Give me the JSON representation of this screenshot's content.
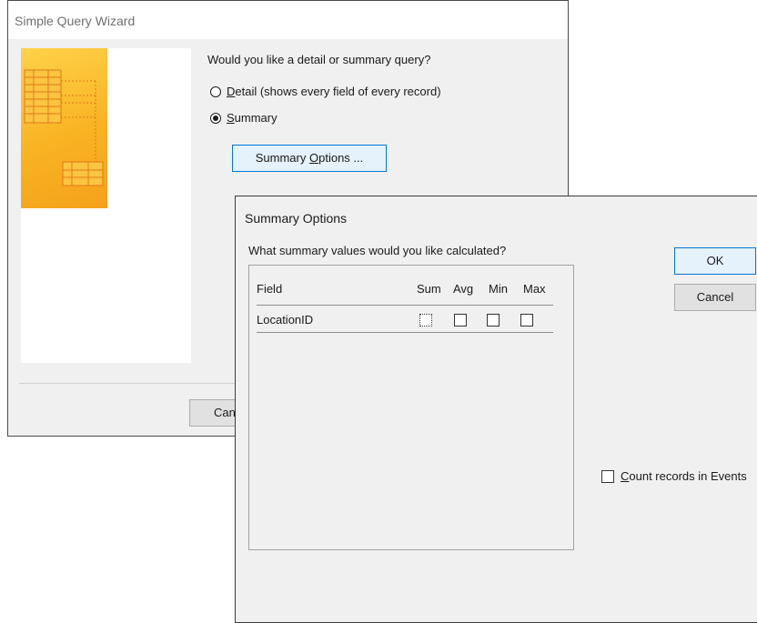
{
  "wizard": {
    "title": "Simple Query Wizard",
    "question": "Would you like a detail or summary query?",
    "options": [
      {
        "mnemonic": "D",
        "rest": "etail (shows every field of every record)",
        "selected": false
      },
      {
        "mnemonic": "S",
        "rest": "ummary",
        "selected": true
      }
    ],
    "summary_button": {
      "before": "Summary ",
      "mnemonic": "O",
      "after": "ptions ..."
    },
    "cancel_label": "Can"
  },
  "dialog": {
    "title": "Summary Options",
    "question": "What summary values would you like calculated?",
    "columns": {
      "field": "Field",
      "sum": "Sum",
      "avg": "Avg",
      "min": "Min",
      "max": "Max"
    },
    "rows": [
      {
        "field": "LocationID",
        "sum": false,
        "avg": false,
        "min": false,
        "max": false
      }
    ],
    "ok_label": "OK",
    "cancel_label": "Cancel",
    "count_records": {
      "mnemonic": "C",
      "rest": "ount records in Events",
      "checked": false
    }
  },
  "colors": {
    "accent": "#0078d7",
    "image_yellow": "#f9b323"
  }
}
